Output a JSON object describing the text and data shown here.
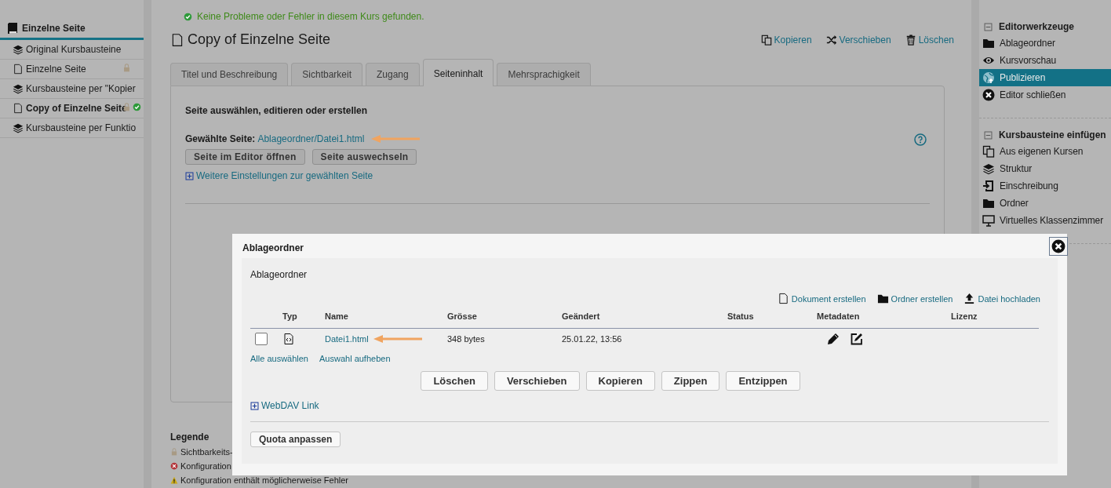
{
  "left_nav": {
    "title": "Einzelne Seite",
    "items": [
      {
        "kind": "layers",
        "label": "Original Kursbausteine",
        "selected": false,
        "locked": false,
        "ok": false
      },
      {
        "kind": "page",
        "label": "Einzelne Seite",
        "selected": false,
        "locked": true,
        "ok": false
      },
      {
        "kind": "layers",
        "label": "Kursbausteine per \"Kopier",
        "selected": false,
        "locked": false,
        "ok": false
      },
      {
        "kind": "page",
        "label": "Copy of Einzelne Seite",
        "selected": true,
        "locked": true,
        "ok": true
      },
      {
        "kind": "layers",
        "label": "Kursbausteine per Funktio",
        "selected": false,
        "locked": false,
        "ok": false
      }
    ]
  },
  "main": {
    "status_message": "Keine Probleme oder Fehler in diesem Kurs gefunden.",
    "page_title": "Copy of Einzelne Seite",
    "actions": [
      {
        "kind": "copy",
        "label": "Kopieren"
      },
      {
        "kind": "shuffle",
        "label": "Verschieben"
      },
      {
        "kind": "trash",
        "label": "Löschen"
      }
    ],
    "tabs": [
      {
        "label": "Titel und Beschreibung",
        "selected": false
      },
      {
        "label": "Sichtbarkeit",
        "selected": false
      },
      {
        "label": "Zugang",
        "selected": false
      },
      {
        "label": "Seiteninhalt",
        "selected": true
      },
      {
        "label": "Mehrsprachigkeit",
        "selected": false
      }
    ],
    "panel": {
      "heading": "Seite auswählen, editieren oder erstellen",
      "chosen_label": "Gewählte Seite:",
      "chosen_link": "Ablageordner/Datei1.html",
      "buttons": [
        "Seite im Editor öffnen",
        "Seite auswechseln"
      ],
      "more_link": "Weitere Einstellungen zur gewählten Seite"
    },
    "legend": {
      "title": "Legende",
      "items": [
        {
          "kind": "lock",
          "label": "Sichtbarkeits-"
        },
        {
          "kind": "error",
          "label": "Konfiguration"
        },
        {
          "kind": "warning",
          "label": "Konfiguration enthält möglicherweise Fehler"
        }
      ]
    }
  },
  "right_sidebar": {
    "sections": [
      {
        "title": "Editorwerkzeuge",
        "expanded": true,
        "items": [
          {
            "kind": "folder",
            "label": "Ablageordner",
            "selected": false
          },
          {
            "kind": "eye",
            "label": "Kursvorschau",
            "selected": false
          },
          {
            "kind": "globe",
            "label": "Publizieren",
            "selected": true
          },
          {
            "kind": "close-circle",
            "label": "Editor schließen",
            "selected": false
          }
        ]
      },
      {
        "title": "Kursbausteine einfügen",
        "expanded": true,
        "items": [
          {
            "kind": "copy",
            "label": "Aus eigenen Kursen",
            "selected": false
          },
          {
            "kind": "layers",
            "label": "Struktur",
            "selected": false
          },
          {
            "kind": "enroll",
            "label": "Einschreibung",
            "selected": false
          },
          {
            "kind": "folder",
            "label": "Ordner",
            "selected": false
          },
          {
            "kind": "monitor",
            "label": "Virtuelles Klassenzimmer",
            "selected": false
          }
        ]
      }
    ]
  },
  "modal": {
    "title": "Ablageordner",
    "folder_name": "Ablageordner",
    "toolbar": [
      {
        "kind": "page",
        "label": "Dokument erstellen"
      },
      {
        "kind": "folder",
        "label": "Ordner erstellen"
      },
      {
        "kind": "upload",
        "label": "Datei hochladen"
      }
    ],
    "columns": [
      "Typ",
      "Name",
      "Grösse",
      "Geändert",
      "Status",
      "Metadaten",
      "Lizenz"
    ],
    "rows": [
      {
        "checked": false,
        "kind": "code",
        "name": "Datei1.html",
        "size": "348 bytes",
        "modified": "25.01.22, 13:56"
      }
    ],
    "select_all": "Alle auswählen",
    "deselect_all": "Auswahl aufheben",
    "buttons": [
      "Löschen",
      "Verschieben",
      "Kopieren",
      "Zippen",
      "Entzippen"
    ],
    "webdav_link": "WebDAV Link",
    "quota_button": "Quota anpassen"
  }
}
